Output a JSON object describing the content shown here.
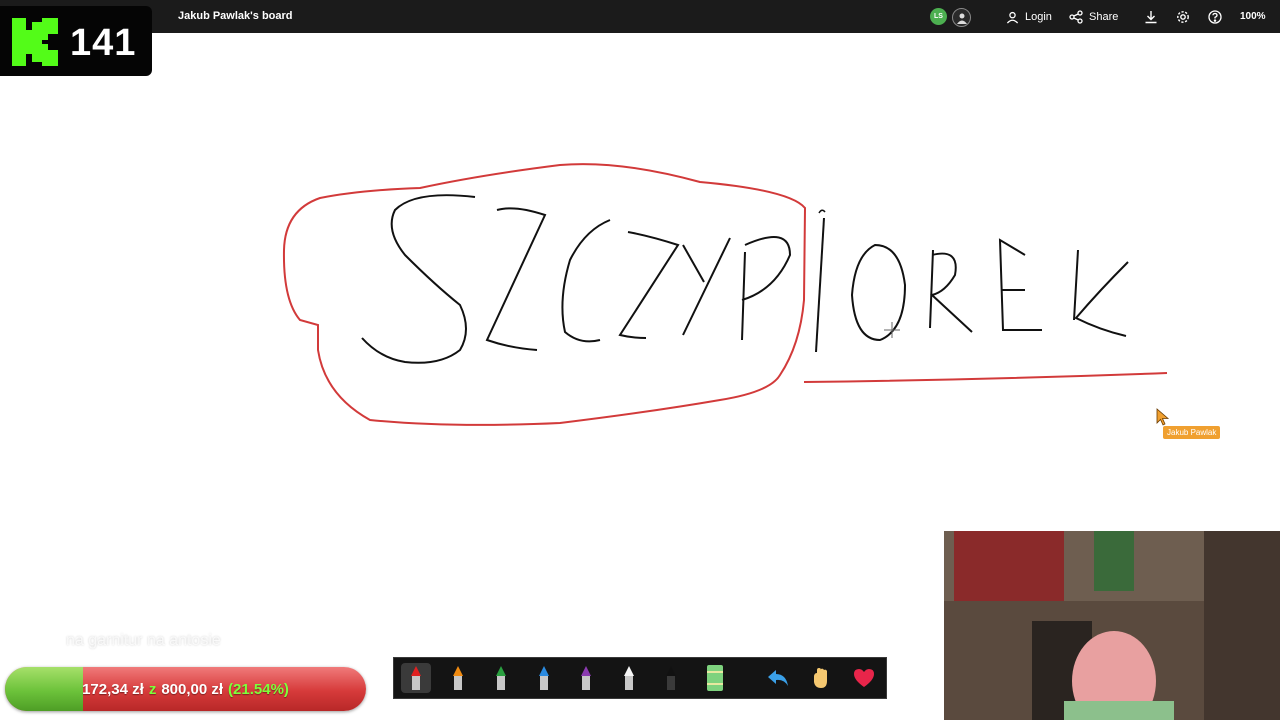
{
  "header": {
    "board_title": "Jakub Pawlak's board",
    "avatar_initials": "LS",
    "login_label": "Login",
    "share_label": "Share",
    "zoom": "100%"
  },
  "overlay": {
    "logo_count": "141",
    "caption": "na garnitur na antosie",
    "donation": {
      "current": "172,34 zł",
      "separator": "z",
      "goal": "800,00 zł",
      "percent_text": "(21.54%)",
      "progress_fraction": 0.2154
    }
  },
  "canvas": {
    "word_boxed": "SZCZYP",
    "word_rest": "IOREK",
    "cursor_name": "Jakub Pawlak"
  },
  "toolbar": {
    "tools": [
      {
        "name": "red-marker",
        "color": "#e02020"
      },
      {
        "name": "orange-marker",
        "color": "#f08a10"
      },
      {
        "name": "green-marker",
        "color": "#2aa040"
      },
      {
        "name": "blue-marker",
        "color": "#2a8ae0"
      },
      {
        "name": "purple-marker",
        "color": "#8a3ab0"
      },
      {
        "name": "white-marker",
        "color": "#f5f5f5"
      },
      {
        "name": "black-marker",
        "color": "#111111"
      },
      {
        "name": "eraser",
        "color": "#7ed27e"
      },
      {
        "name": "undo",
        "icon": "undo-arrow-icon"
      },
      {
        "name": "hand",
        "icon": "hand-icon"
      },
      {
        "name": "heart",
        "icon": "heart-icon"
      }
    ]
  }
}
